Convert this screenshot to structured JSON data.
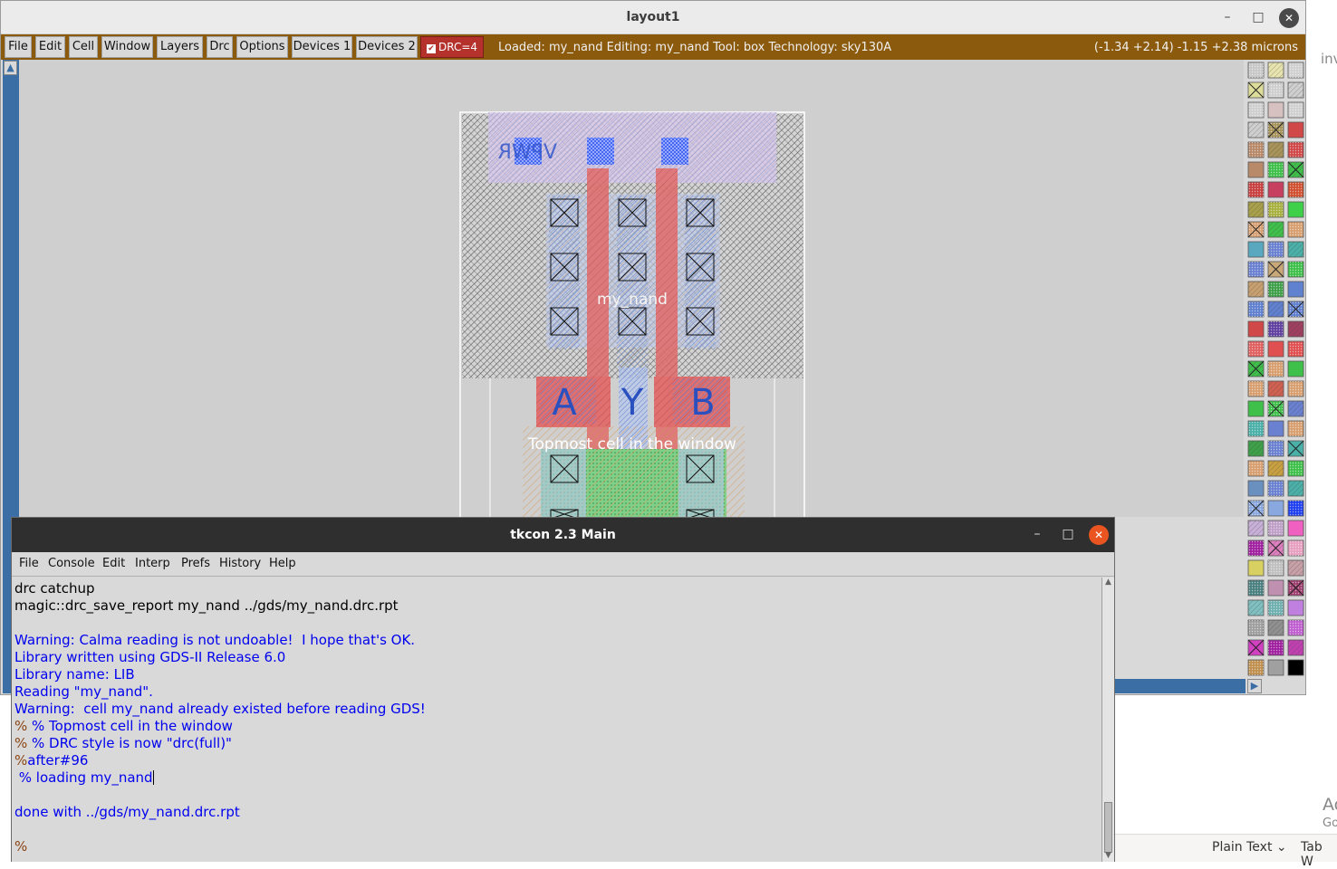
{
  "layout_window": {
    "title": "layout1",
    "menu": [
      "File",
      "Edit",
      "Cell",
      "Window",
      "Layers",
      "Drc",
      "Options",
      "Devices 1",
      "Devices 2"
    ],
    "drc_label": "DRC=4",
    "status": "Loaded: my_nand Editing: my_nand Tool: box  Technology: sky130A",
    "coords": "(-1.34 +2.14) -1.15 +2.38 microns",
    "cell_name": "my_nand",
    "cell_top_label": "VPWR",
    "pin_labels": [
      "A",
      "Y",
      "B"
    ],
    "canvas_message": "Topmost cell in the window"
  },
  "tkcon": {
    "title": "tkcon 2.3 Main",
    "menu": [
      "File",
      "Console",
      "Edit",
      "Interp",
      "Prefs",
      "History",
      "Help"
    ],
    "lines": [
      {
        "text": "drc catchup",
        "style": "black"
      },
      {
        "text": "magic::drc_save_report my_nand ../gds/my_nand.drc.rpt",
        "style": "black"
      },
      {
        "text": "",
        "style": "black"
      },
      {
        "text": "Warning: Calma reading is not undoable!  I hope that's OK.",
        "style": "blue"
      },
      {
        "text": "Library written using GDS-II Release 6.0",
        "style": "blue"
      },
      {
        "text": "Library name: LIB",
        "style": "blue"
      },
      {
        "text": "Reading \"my_nand\".",
        "style": "blue"
      },
      {
        "text": "Warning:  cell my_nand already existed before reading GDS!",
        "style": "blue"
      },
      {
        "prompt": "% ",
        "text": "% Topmost cell in the window",
        "style": "blue"
      },
      {
        "prompt": "% ",
        "text": "% DRC style is now \"drc(full)\"",
        "style": "blue"
      },
      {
        "prompt": "%",
        "text": "after#96",
        "style": "blue"
      },
      {
        "prompt": " ",
        "text": "% loading my_nand",
        "style": "blue",
        "cursor": true
      },
      {
        "text": "",
        "style": "black"
      },
      {
        "text": "done with ../gds/my_nand.drc.rpt",
        "style": "blue"
      },
      {
        "text": "",
        "style": "black"
      },
      {
        "prompt": "%",
        "text": "",
        "style": "blue"
      }
    ]
  },
  "background": {
    "status_items": [
      "Plain Text",
      "Tab W"
    ],
    "frag_top": "inv",
    "frag_right_1": "Ac",
    "frag_right_2": "Go"
  },
  "colors": {
    "menubar": "#8b5a0c",
    "drc_button": "#b4312c",
    "console_blue": "#0000ee",
    "tk_close": "#e95420"
  },
  "icons": {
    "minimize": "minimize-icon",
    "maximize": "maximize-icon",
    "close": "close-icon",
    "scroll_up": "arrow-up-icon",
    "scroll_right": "arrow-right-icon",
    "drc_check": "checkbox-icon"
  }
}
